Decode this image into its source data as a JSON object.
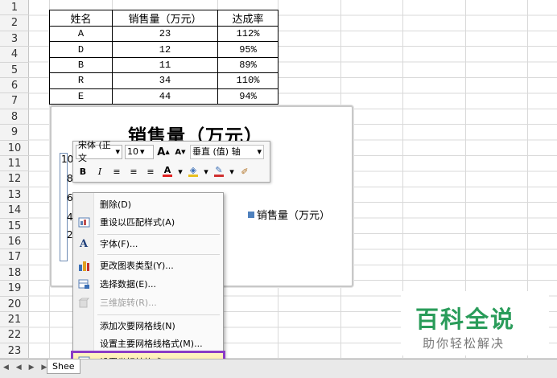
{
  "rows": [
    "1",
    "2",
    "3",
    "4",
    "5",
    "6",
    "7",
    "8",
    "9",
    "10",
    "11",
    "12",
    "13",
    "14",
    "15",
    "16",
    "17",
    "18",
    "19",
    "20",
    "21",
    "22",
    "23"
  ],
  "table": {
    "headers": [
      "姓名",
      "销售量（万元）",
      "达成率"
    ],
    "rows": [
      [
        "A",
        "23",
        "112%"
      ],
      [
        "D",
        "12",
        "95%"
      ],
      [
        "B",
        "11",
        "89%"
      ],
      [
        "R",
        "34",
        "110%"
      ],
      [
        "E",
        "44",
        "94%"
      ]
    ]
  },
  "chart": {
    "title": "销售量（万元）",
    "legend": "销售量（万元）",
    "visible_ticks": [
      "10",
      "8",
      "6",
      "4",
      "2"
    ],
    "legend_color": "#4f81bd"
  },
  "mini_toolbar": {
    "font_name": "宋体 (正文",
    "font_size": "10",
    "grow_font": "A",
    "shrink_font": "A",
    "element_select": "垂直 (值) 轴",
    "bold": "B",
    "italic": "I",
    "font_color_letter": "A"
  },
  "context_menu": {
    "items": [
      {
        "label": "删除(D)"
      },
      {
        "label": "重设以匹配样式(A)"
      },
      {
        "label": "字体(F)..."
      },
      {
        "label": "更改图表类型(Y)..."
      },
      {
        "label": "选择数据(E)..."
      },
      {
        "label": "三维旋转(R)..."
      },
      {
        "label": "添加次要网格线(N)"
      },
      {
        "label": "设置主要网格线格式(M)..."
      },
      {
        "label": "设置坐标轴格式(F)..."
      }
    ],
    "highlight_color": "#8b3cc6"
  },
  "sheet_tab": {
    "label": "Shee",
    "nav": "◀ ◀ ▶ ▶|"
  },
  "watermark": {
    "title": "百科全说",
    "subtitle": "助你轻松解决",
    "color": "#2a9c5a"
  }
}
